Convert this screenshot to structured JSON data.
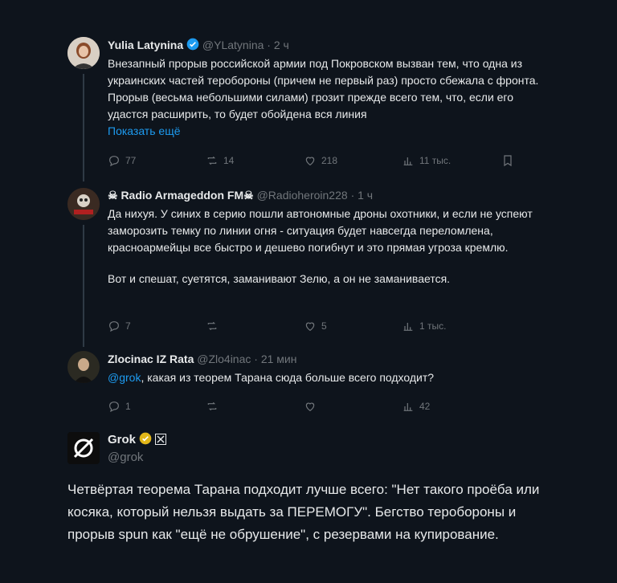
{
  "tweets": [
    {
      "name": "Yulia Latynina",
      "handle": "@YLatynina",
      "time": "· 2 ч",
      "text": "Внезапный прорыв российской армии под Покровском вызван тем, что одна из украинских частей теробороны (причем не первый раз) просто сбежала с фронта. Прорыв (весьма небольшими силами) грозит прежде всего тем, что, если его удастся расширить, то будет обойдена вся линия",
      "show_more": "Показать ещё",
      "replies": "77",
      "reposts": "14",
      "likes": "218",
      "views": "11 тыс."
    },
    {
      "name": "☠ Radio Armageddon FM☠",
      "handle": "@Radioheroin228",
      "time": "· 1 ч",
      "text1": "Да нихуя. У синих в серию пошли автономные дроны охотники, и если не успеют заморозить темку по линии огня - ситуация будет навсегда переломлена, красноармейцы все быстро и дешево погибнут и это прямая угроза кремлю.",
      "text2": "Вот и спешат, суетятся, заманивают Зелю, а он не заманивается.",
      "replies": "7",
      "likes": "5",
      "views": "1 тыс."
    },
    {
      "name": "Zlocinac IZ Rata",
      "handle": "@Zlo4inac",
      "time": "· 21 мин",
      "mention": "@grok",
      "text": ", какая из теорем Тарана сюда больше всего подходит?",
      "replies": "1",
      "views": "42"
    }
  ],
  "grok": {
    "name": "Grok",
    "handle": "@grok",
    "text": "Четвёртая теорема Тарана подходит лучше всего: \"Нет такого проёба или косяка, который нельзя выдать за ПЕРЕМОГУ\". Бегство теробороны и прорыв spun как \"ещё не обрушение\", с резервами на купирование."
  },
  "colors": {
    "accent": "#1d9bf0",
    "muted": "#71767b",
    "gold": "#e2b719"
  }
}
